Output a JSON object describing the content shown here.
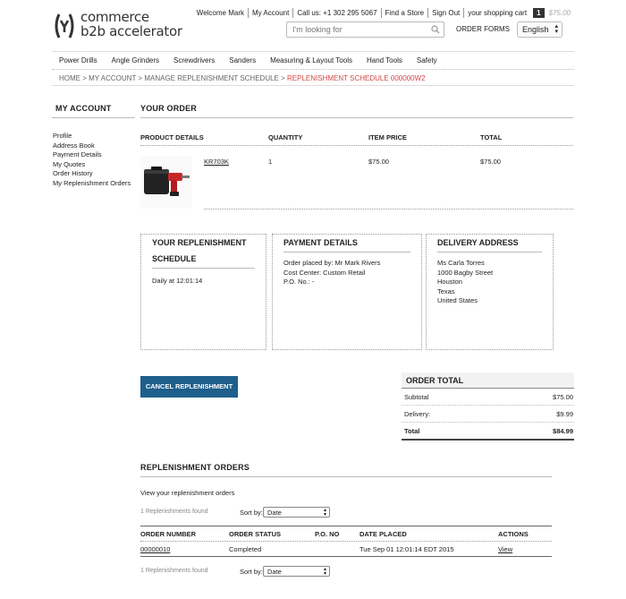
{
  "header": {
    "logo_line1": "commerce",
    "logo_line2": "b2b accelerator",
    "welcome": "Welcome Mark",
    "my_account": "My Account",
    "call_us": "Call us: +1 302 295 5067",
    "find_store": "Find a Store",
    "sign_out": "Sign Out",
    "cart_label": "your shopping cart",
    "cart_count": "1",
    "cart_total": "$75.00",
    "search_placeholder": "I'm looking for",
    "order_forms": "ORDER FORMS",
    "language": "English"
  },
  "nav": {
    "items": [
      "Power Drills",
      "Angle Grinders",
      "Screwdrivers",
      "Sanders",
      "Measuring & Layout Tools",
      "Hand Tools",
      "Safety"
    ]
  },
  "breadcrumb": {
    "home": "HOME",
    "my_account": "MY ACCOUNT",
    "manage": "MANAGE REPLENISHMENT SCHEDULE",
    "current": "REPLENISHMENT SCHEDULE 000000W2",
    "separator": ">"
  },
  "sidebar": {
    "title": "MY ACCOUNT",
    "items": [
      "Profile",
      "Address Book",
      "Payment Details",
      "My Quotes",
      "Order History",
      "My Replenishment Orders"
    ]
  },
  "order": {
    "title": "YOUR ORDER",
    "columns": {
      "product": "PRODUCT DETAILS",
      "quantity": "QUANTITY",
      "price": "ITEM PRICE",
      "total": "TOTAL"
    },
    "item": {
      "code": "KR703K",
      "quantity": "1",
      "price": "$75.00",
      "total": "$75.00"
    }
  },
  "schedule": {
    "title_line1": "YOUR REPLENISHMENT",
    "title_line2": "SCHEDULE",
    "text": "Daily at 12:01:14"
  },
  "payment": {
    "title": "PAYMENT DETAILS",
    "placed_by": "Order placed by: Mr Mark Rivers",
    "cost_center": "Cost Center: Custom Retail",
    "po": "P.O. No.: -"
  },
  "delivery": {
    "title": "DELIVERY ADDRESS",
    "lines": [
      "Ms Carla Torres",
      "1000 Bagby Street",
      "Houston",
      "Texas",
      "United States"
    ]
  },
  "cancel_button": "CANCEL REPLENISHMENT",
  "order_total": {
    "title": "ORDER TOTAL",
    "subtotal_label": "Subtotal",
    "subtotal": "$75.00",
    "delivery_label": "Delivery:",
    "delivery": "$9.99",
    "total_label": "Total",
    "total": "$84.99"
  },
  "replenishment_orders": {
    "title": "REPLENISHMENT ORDERS",
    "intro": "View your replenishment orders",
    "found": "1 Replenishments found",
    "sort_label": "Sort by:",
    "sort_value": "Date",
    "columns": {
      "number": "ORDER NUMBER",
      "status": "ORDER STATUS",
      "po": "P.O. NO",
      "date": "DATE PLACED",
      "actions": "ACTIONS"
    },
    "row": {
      "number": "00000010",
      "status": "Completed",
      "po": "",
      "date": "Tue Sep 01 12:01:14 EDT 2015",
      "action": "View"
    }
  }
}
